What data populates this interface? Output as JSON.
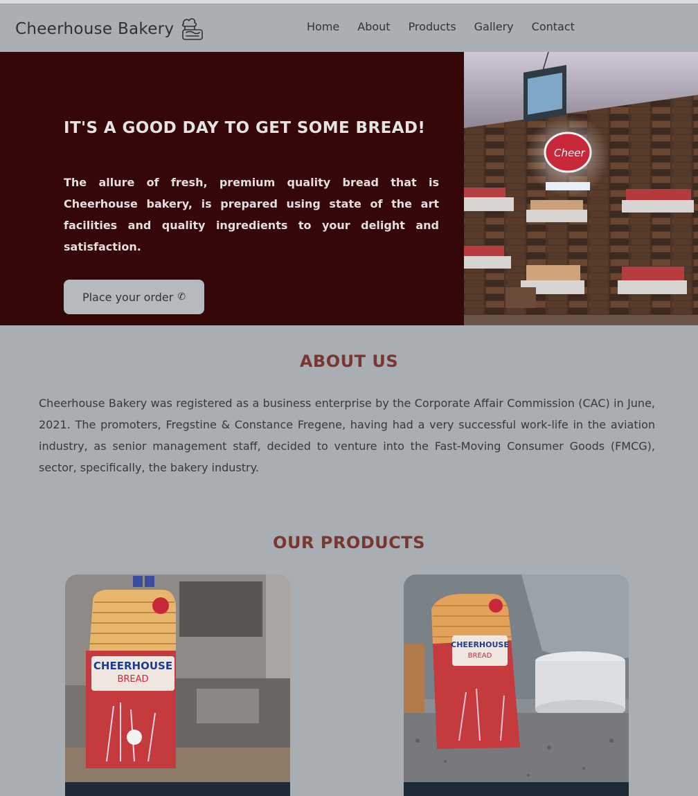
{
  "header": {
    "brand": "Cheerhouse Bakery",
    "nav": [
      "Home",
      "About",
      "Products",
      "Gallery",
      "Contact"
    ]
  },
  "hero": {
    "title": "IT'S A GOOD DAY TO GET SOME BREAD!",
    "text": "The allure of fresh, premium quality bread that is Cheerhouse bakery, is prepared using state of the art facilities and quality ingredients to your delight and satisfaction.",
    "button_label": "Place your order",
    "button_icon": "phone-icon"
  },
  "about": {
    "title": "ABOUT US",
    "text": "Cheerhouse Bakery was registered as a business enterprise by the Corporate Affair Commission (CAC) in June, 2021. The promoters, Fregstine & Constance Fregene, having had a very successful work-life in the aviation industry, as senior management staff, decided to venture into the Fast-Moving Consumer Goods (FMCG), sector, specifically, the bakery industry."
  },
  "products": {
    "title": "OUR PRODUCTS",
    "items": [
      {
        "package_brand": "CHEERHOUSE",
        "package_type": "BREAD"
      },
      {
        "package_brand": "CHEERHOUSE",
        "package_type": "BREAD"
      }
    ]
  },
  "colors": {
    "hero_bg": "#360708",
    "page_bg": "#a8aeb2",
    "heading_accent": "#7a3630",
    "card_bar": "#1e2a36"
  }
}
